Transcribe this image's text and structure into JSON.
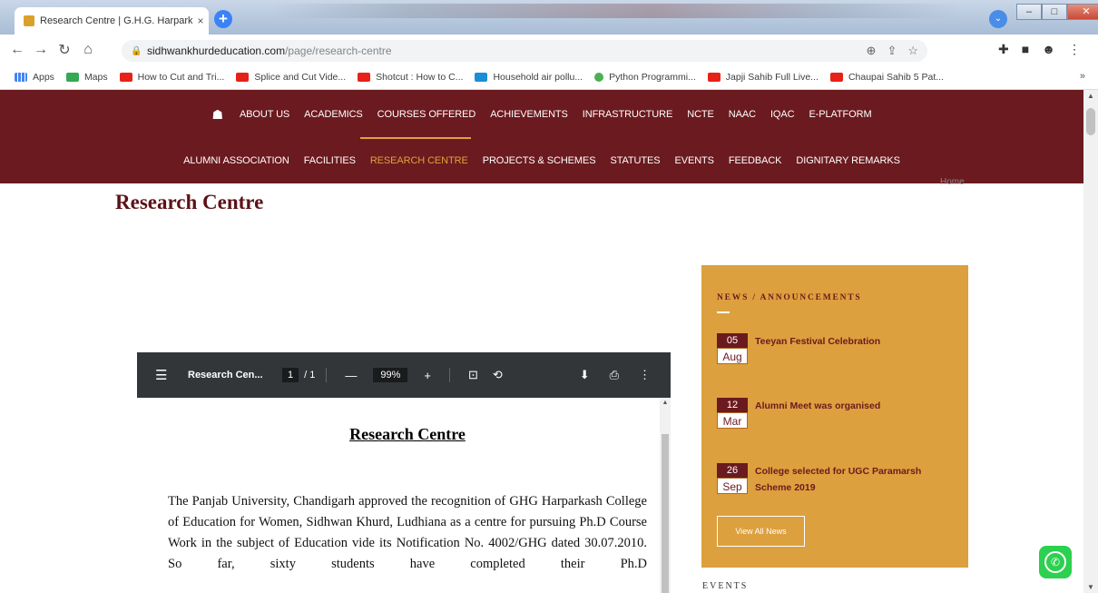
{
  "browser": {
    "tab_title": "Research Centre | G.H.G. Harpark",
    "tab_close": "×",
    "new_tab": "+",
    "url_host": "sidhwankhurdeducation.com",
    "url_path": "/page/research-centre",
    "bookmarks": [
      {
        "label": "Apps",
        "icon": "apps-grid-icon"
      },
      {
        "label": "Maps",
        "icon": "maps-icon"
      },
      {
        "label": "How to Cut and Tri...",
        "icon": "youtube-icon"
      },
      {
        "label": "Splice and Cut Vide...",
        "icon": "youtube-icon"
      },
      {
        "label": "Shotcut : How to C...",
        "icon": "youtube-icon"
      },
      {
        "label": "Household air pollu...",
        "icon": "un-icon"
      },
      {
        "label": "Python Programmi...",
        "icon": "python-icon"
      },
      {
        "label": "Japji Sahib Full Live...",
        "icon": "youtube-icon"
      },
      {
        "label": "Chaupai Sahib 5 Pat...",
        "icon": "youtube-icon"
      }
    ],
    "bookmarks_more": "»"
  },
  "site_nav": {
    "row1": [
      "ABOUT US",
      "ACADEMICS",
      "COURSES OFFERED",
      "ACHIEVEMENTS",
      "INFRASTRUCTURE",
      "NCTE",
      "NAAC",
      "IQAC",
      "E-PLATFORM"
    ],
    "row2": [
      "ALUMNI ASSOCIATION",
      "FACILITIES",
      "RESEARCH CENTRE",
      "PROJECTS & SCHEMES",
      "STATUTES",
      "EVENTS",
      "FEEDBACK",
      "DIGNITARY REMARKS"
    ],
    "active": "RESEARCH CENTRE",
    "colors": {
      "bar": "#6b1a1f",
      "active": "#e2a13c"
    }
  },
  "breadcrumb": "Home",
  "page_title": "Research Centre",
  "pdf": {
    "doc_name": "Research Cen...",
    "page_current": "1",
    "page_total": "/ 1",
    "zoom": "99%",
    "heading": "Research Centre",
    "body": "The Panjab University, Chandigarh approved the recognition of GHG Harparkash College of Education for Women, Sidhwan Khurd, Ludhiana as a centre for pursuing Ph.D Course Work in the subject of Education vide its Notification No. 4002/GHG dated 30.07.2010. So far, sixty students have completed their Ph.D"
  },
  "news": {
    "heading": "NEWS / ANNOUNCEMENTS",
    "items": [
      {
        "day": "05",
        "month": "Aug",
        "text": "Teeyan Festival Celebration"
      },
      {
        "day": "12",
        "month": "Mar",
        "text": "Alumni Meet was organised"
      },
      {
        "day": "26",
        "month": "Sep",
        "text": "College selected for UGC Paramarsh Scheme 2019"
      }
    ],
    "view_all": "View All News",
    "colors": {
      "panel": "#dca03e",
      "accent": "#6b1a1f"
    }
  },
  "events_heading": "EVENTS"
}
